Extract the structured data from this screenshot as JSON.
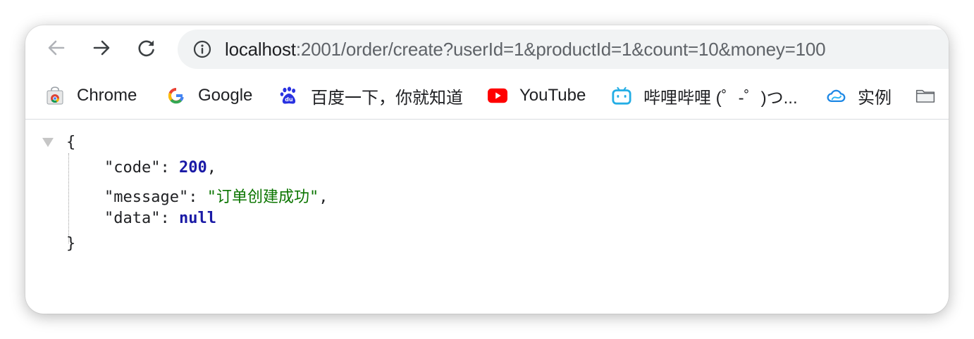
{
  "toolbar": {
    "back_icon": "arrow-left-icon",
    "forward_icon": "arrow-right-icon",
    "reload_icon": "reload-icon",
    "url_host": "localhost",
    "url_path": ":2001/order/create?userId=1&productId=1&count=10&money=100"
  },
  "bookmarks": {
    "items": [
      {
        "label": "Chrome",
        "icon": "chrome-store-icon"
      },
      {
        "label": "Google",
        "icon": "google-icon"
      },
      {
        "label": "百度一下，你就知道",
        "icon": "baidu-icon"
      },
      {
        "label": "YouTube",
        "icon": "youtube-icon"
      },
      {
        "label": "哔哩哔哩 (゜-゜)つ...",
        "icon": "bilibili-icon"
      },
      {
        "label": "实例",
        "icon": "cloud-icon"
      },
      {
        "label": "",
        "icon": "folder-icon"
      }
    ]
  },
  "json_view": {
    "open_brace": "{",
    "close_brace": "}",
    "entries": [
      {
        "key": "\"code\"",
        "sep": ": ",
        "value": "200",
        "trail": ","
      },
      {
        "key": "\"message\"",
        "sep": ": ",
        "value": "\"订单创建成功\"",
        "trail": ","
      },
      {
        "key": "\"data\"",
        "sep": ": ",
        "value": "null",
        "trail": ""
      }
    ]
  },
  "colors": {
    "number": "#1a1aa6",
    "string": "#0b7500",
    "keyword": "#1a1aa6",
    "omnibox_bg": "#f1f3f4"
  }
}
